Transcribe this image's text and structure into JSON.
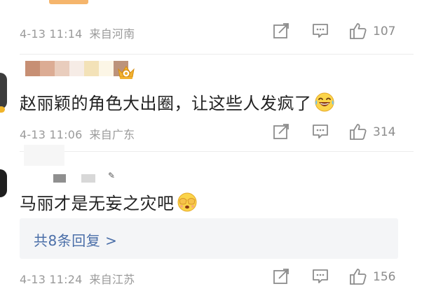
{
  "colors": {
    "meta_text": "#9a9a9a",
    "comment_text": "#222222",
    "replies_link": "#4a6ea8",
    "replies_bg": "#f4f5f7",
    "top_accent": "#f5b56c"
  },
  "icons": {
    "share": "share-icon",
    "comment": "comment-icon",
    "like": "thumb-up-icon",
    "vip_badge": "crown-icon",
    "laugh_emoji": "laugh-tears-emoji",
    "cover_face_emoji": "cover-face-emoji"
  },
  "comments": [
    {
      "time": "4-13 11:14",
      "location": "来自河南",
      "likes": "107"
    },
    {
      "text": "赵丽颖的角色大出圈，让这些人发疯了",
      "time": "4-13 11:06",
      "location": "来自广东",
      "likes": "314"
    },
    {
      "text": "马丽才是无妄之灾吧",
      "replies_label": "共8条回复 >",
      "time": "4-13 11:24",
      "location": "来自江苏",
      "likes": "156"
    }
  ]
}
